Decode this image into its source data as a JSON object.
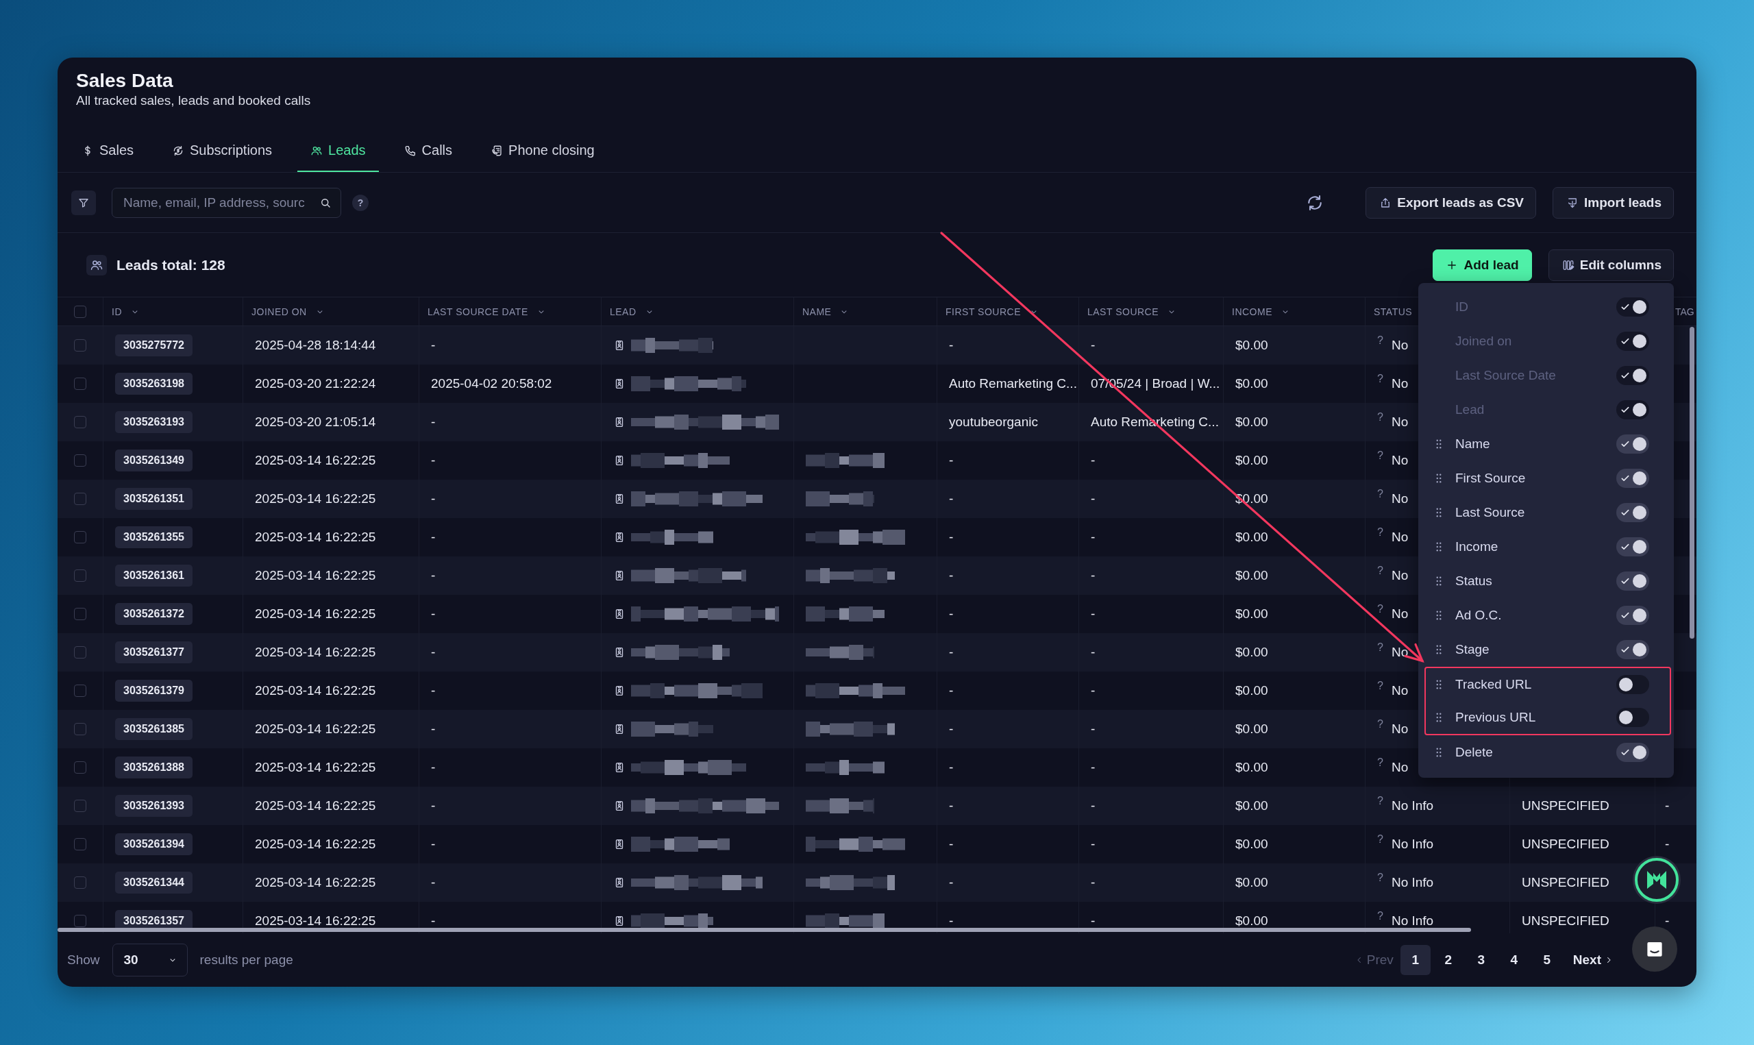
{
  "header": {
    "title": "Sales Data",
    "subtitle": "All tracked sales, leads and booked calls"
  },
  "tabs": [
    {
      "label": "Sales",
      "selected": false
    },
    {
      "label": "Subscriptions",
      "selected": false
    },
    {
      "label": "Leads",
      "selected": true
    },
    {
      "label": "Calls",
      "selected": false
    },
    {
      "label": "Phone closing",
      "selected": false
    }
  ],
  "toolbar": {
    "search": {
      "placeholder": "Name, email, IP address, sourc"
    },
    "help": "?",
    "buttons": [
      "Export leads as CSV",
      "Import leads"
    ]
  },
  "summary": {
    "label": "Leads total: 128",
    "add_button": "Add lead",
    "edit_button": "Edit columns"
  },
  "column_menu": {
    "items": [
      {
        "label": "ID",
        "on": true,
        "disabled": true,
        "highlighted": false
      },
      {
        "label": "Joined on",
        "on": true,
        "disabled": true,
        "highlighted": false
      },
      {
        "label": "Last Source Date",
        "on": true,
        "disabled": true,
        "highlighted": false
      },
      {
        "label": "Lead",
        "on": true,
        "disabled": true,
        "highlighted": false
      },
      {
        "label": "Name",
        "on": true,
        "disabled": false,
        "highlighted": false
      },
      {
        "label": "First Source",
        "on": true,
        "disabled": false,
        "highlighted": false
      },
      {
        "label": "Last Source",
        "on": true,
        "disabled": false,
        "highlighted": false
      },
      {
        "label": "Income",
        "on": true,
        "disabled": false,
        "highlighted": false
      },
      {
        "label": "Status",
        "on": true,
        "disabled": false,
        "highlighted": false
      },
      {
        "label": "Ad O.C.",
        "on": true,
        "disabled": false,
        "highlighted": false
      },
      {
        "label": "Stage",
        "on": true,
        "disabled": false,
        "highlighted": false
      },
      {
        "label": "Tracked URL",
        "on": false,
        "disabled": false,
        "highlighted": true
      },
      {
        "label": "Previous URL",
        "on": false,
        "disabled": false,
        "highlighted": true
      },
      {
        "label": "Delete",
        "on": true,
        "disabled": false,
        "highlighted": false
      }
    ]
  },
  "table": {
    "select_all": {
      "checked": false
    },
    "columns": [
      "ID",
      "JOINED ON",
      "LAST SOURCE DATE",
      "LEAD",
      "NAME",
      "FIRST SOURCE",
      "LAST SOURCE",
      "INCOME",
      "STATUS"
    ],
    "last_column": "TAG",
    "rows": [
      {
        "checked": false,
        "id": "3035275772",
        "joined_on": "2025-04-28 18:14:44",
        "last_source_date": "-",
        "first_source": "-",
        "last_source": "-",
        "income": "$0.00",
        "status_hint": "?",
        "status": "No"
      },
      {
        "checked": false,
        "id": "3035263198",
        "joined_on": "2025-03-20 21:22:24",
        "last_source_date": "2025-04-02 20:58:02",
        "first_source": "Auto Remarketing C...",
        "last_source": "07/05/24 | Broad | W...",
        "income": "$0.00",
        "status_hint": "?",
        "status": "No"
      },
      {
        "checked": false,
        "id": "3035263193",
        "joined_on": "2025-03-20 21:05:14",
        "last_source_date": "-",
        "first_source": "youtubeorganic",
        "last_source": "Auto Remarketing C...",
        "income": "$0.00",
        "status_hint": "?",
        "status": "No"
      },
      {
        "checked": false,
        "id": "3035261349",
        "joined_on": "2025-03-14 16:22:25",
        "last_source_date": "-",
        "first_source": "-",
        "last_source": "-",
        "income": "$0.00",
        "status_hint": "?",
        "status": "No"
      },
      {
        "checked": false,
        "id": "3035261351",
        "joined_on": "2025-03-14 16:22:25",
        "last_source_date": "-",
        "first_source": "-",
        "last_source": "-",
        "income": "$0.00",
        "status_hint": "?",
        "status": "No"
      },
      {
        "checked": false,
        "id": "3035261355",
        "joined_on": "2025-03-14 16:22:25",
        "last_source_date": "-",
        "first_source": "-",
        "last_source": "-",
        "income": "$0.00",
        "status_hint": "?",
        "status": "No"
      },
      {
        "checked": false,
        "id": "3035261361",
        "joined_on": "2025-03-14 16:22:25",
        "last_source_date": "-",
        "first_source": "-",
        "last_source": "-",
        "income": "$0.00",
        "status_hint": "?",
        "status": "No"
      },
      {
        "checked": false,
        "id": "3035261372",
        "joined_on": "2025-03-14 16:22:25",
        "last_source_date": "-",
        "first_source": "-",
        "last_source": "-",
        "income": "$0.00",
        "status_hint": "?",
        "status": "No"
      },
      {
        "checked": false,
        "id": "3035261377",
        "joined_on": "2025-03-14 16:22:25",
        "last_source_date": "-",
        "first_source": "-",
        "last_source": "-",
        "income": "$0.00",
        "status_hint": "?",
        "status": "No"
      },
      {
        "checked": false,
        "id": "3035261379",
        "joined_on": "2025-03-14 16:22:25",
        "last_source_date": "-",
        "first_source": "-",
        "last_source": "-",
        "income": "$0.00",
        "status_hint": "?",
        "status": "No"
      },
      {
        "checked": false,
        "id": "3035261385",
        "joined_on": "2025-03-14 16:22:25",
        "last_source_date": "-",
        "first_source": "-",
        "last_source": "-",
        "income": "$0.00",
        "status_hint": "?",
        "status": "No"
      },
      {
        "checked": false,
        "id": "3035261388",
        "joined_on": "2025-03-14 16:22:25",
        "last_source_date": "-",
        "first_source": "-",
        "last_source": "-",
        "income": "$0.00",
        "status_hint": "?",
        "status": "No"
      },
      {
        "checked": false,
        "id": "3035261393",
        "joined_on": "2025-03-14 16:22:25",
        "last_source_date": "-",
        "first_source": "-",
        "last_source": "-",
        "income": "$0.00",
        "status_hint": "?",
        "status": "No Info",
        "stage": "UNSPECIFIED",
        "tag": "-"
      },
      {
        "checked": false,
        "id": "3035261394",
        "joined_on": "2025-03-14 16:22:25",
        "last_source_date": "-",
        "first_source": "-",
        "last_source": "-",
        "income": "$0.00",
        "status_hint": "?",
        "status": "No Info",
        "stage": "UNSPECIFIED",
        "tag": "-"
      },
      {
        "checked": false,
        "id": "3035261344",
        "joined_on": "2025-03-14 16:22:25",
        "last_source_date": "-",
        "first_source": "-",
        "last_source": "-",
        "income": "$0.00",
        "status_hint": "?",
        "status": "No Info",
        "stage": "UNSPECIFIED"
      },
      {
        "checked": false,
        "id": "3035261357",
        "joined_on": "2025-03-14 16:22:25",
        "last_source_date": "-",
        "first_source": "-",
        "last_source": "-",
        "income": "$0.00",
        "status_hint": "?",
        "status": "No Info",
        "stage": "UNSPECIFIED",
        "tag": "-"
      }
    ]
  },
  "footer": {
    "show_label": "Show",
    "per_page": "30",
    "per_page_suffix": "results per page"
  },
  "pagination": {
    "prev": {
      "label": "Prev",
      "disabled": true
    },
    "next": {
      "label": "Next",
      "disabled": false
    },
    "pages": [
      {
        "label": "1",
        "selected": true
      },
      {
        "label": "2",
        "selected": false
      },
      {
        "label": "3",
        "selected": false
      },
      {
        "label": "4",
        "selected": false
      },
      {
        "label": "5",
        "selected": false
      }
    ]
  }
}
